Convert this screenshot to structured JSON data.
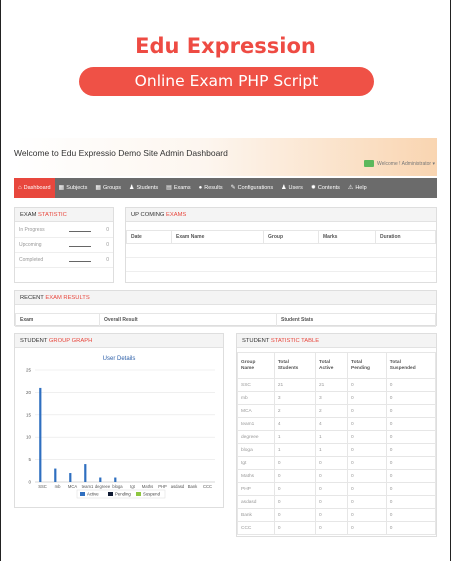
{
  "hero": {
    "title": "Edu Expression",
    "subtitle": "Online Exam PHP Script"
  },
  "header": {
    "welcome": "Welcome to Edu Expressio Demo Site Admin Dashboard",
    "user": "Welcome ! Administrator ▾"
  },
  "nav": [
    {
      "label": "Dashboard",
      "icon": "home-icon",
      "glyph": "⌂"
    },
    {
      "label": "Subjects",
      "icon": "grid-icon",
      "glyph": "▦"
    },
    {
      "label": "Groups",
      "icon": "grid-icon",
      "glyph": "▦"
    },
    {
      "label": "Students",
      "icon": "user-icon",
      "glyph": "♟"
    },
    {
      "label": "Exams",
      "icon": "list-icon",
      "glyph": "▤"
    },
    {
      "label": "Results",
      "icon": "circle-icon",
      "glyph": "●"
    },
    {
      "label": "Configurations",
      "icon": "wrench-icon",
      "glyph": "✎"
    },
    {
      "label": "Users",
      "icon": "user-icon",
      "glyph": "♟"
    },
    {
      "label": "Contents",
      "icon": "gear-icon",
      "glyph": "✹"
    },
    {
      "label": "Help",
      "icon": "warning-icon",
      "glyph": "⚠"
    }
  ],
  "exam_statistic": {
    "title_plain": "EXAM ",
    "title_hl": "STATISTIC",
    "rows": [
      {
        "label": "In Progress",
        "value": "0"
      },
      {
        "label": "Upcoming",
        "value": "0"
      },
      {
        "label": "Completed",
        "value": "0"
      }
    ]
  },
  "upcoming": {
    "title_plain": "UP COMING ",
    "title_hl": "EXAMS",
    "columns": [
      "Date",
      "Exam Name",
      "Group",
      "Marks",
      "Duration"
    ]
  },
  "recent": {
    "title_plain": "RECENT ",
    "title_hl": "EXAM RESULTS",
    "columns": [
      "Exam",
      "Overall Result",
      "Student Stats"
    ]
  },
  "group_graph": {
    "title_plain": "STUDENT ",
    "title_hl": "GROUP GRAPH",
    "chart_title": "User Details"
  },
  "chart_data": {
    "type": "bar",
    "title": "User Details",
    "categories": [
      "SSC",
      "mb",
      "MCA",
      "team1",
      "degreee",
      "bloga",
      "tgt",
      "Maths",
      "PHP",
      "asdasd",
      "Bank",
      "CCC"
    ],
    "series": [
      {
        "name": "Active",
        "color": "#2f6fc0",
        "values": [
          21,
          3,
          2,
          4,
          1,
          1,
          0,
          0,
          0,
          0,
          0,
          0
        ]
      },
      {
        "name": "Pending",
        "color": "#0f1a33",
        "values": [
          0,
          0,
          0,
          0,
          0,
          0,
          0,
          0,
          0,
          0,
          0,
          0
        ]
      },
      {
        "name": "Suspend",
        "color": "#8dc63f",
        "values": [
          0,
          0,
          0,
          0,
          0,
          0,
          0,
          0,
          0,
          0,
          0,
          0
        ]
      }
    ],
    "yticks": [
      0,
      5,
      10,
      15,
      20,
      25
    ],
    "ylim": [
      0,
      25
    ],
    "grid": true,
    "legend": "bottom"
  },
  "stat_table": {
    "title_plain": "STUDENT ",
    "title_hl": "STATISTIC TABLE",
    "columns": [
      [
        "Group",
        "Name"
      ],
      [
        "Total",
        "Students"
      ],
      [
        "Total",
        "Active"
      ],
      [
        "Total",
        "Pending"
      ],
      [
        "Total",
        "Suspended"
      ]
    ],
    "rows": [
      [
        "SSC",
        "21",
        "21",
        "0",
        "0"
      ],
      [
        "mb",
        "3",
        "3",
        "0",
        "0"
      ],
      [
        "MCA",
        "2",
        "2",
        "0",
        "0"
      ],
      [
        "team1",
        "4",
        "4",
        "0",
        "0"
      ],
      [
        "degreee",
        "1",
        "1",
        "0",
        "0"
      ],
      [
        "bloga",
        "1",
        "1",
        "0",
        "0"
      ],
      [
        "tgt",
        "0",
        "0",
        "0",
        "0"
      ],
      [
        "Maths",
        "0",
        "0",
        "0",
        "0"
      ],
      [
        "PHP",
        "0",
        "0",
        "0",
        "0"
      ],
      [
        "asdasd",
        "0",
        "0",
        "0",
        "0"
      ],
      [
        "Bank",
        "0",
        "0",
        "0",
        "0"
      ],
      [
        "CCC",
        "0",
        "0",
        "0",
        "0"
      ]
    ]
  }
}
